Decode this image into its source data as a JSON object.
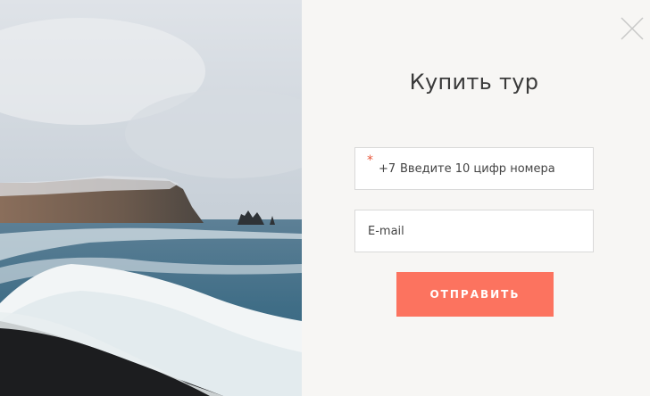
{
  "popup": {
    "title": "Купить тур",
    "close_icon": "close-icon",
    "image_alt_icon": "seascape-photo"
  },
  "form": {
    "required_mark": "*",
    "phone_prefix": "+7",
    "phone_placeholder": "Введите 10 цифр номера",
    "email_placeholder": "E-mail",
    "submit_label": "ОТПРАВИТЬ"
  },
  "colors": {
    "accent": "#fc735f",
    "required": "#e8563a",
    "panel_bg": "#f7f6f4"
  }
}
